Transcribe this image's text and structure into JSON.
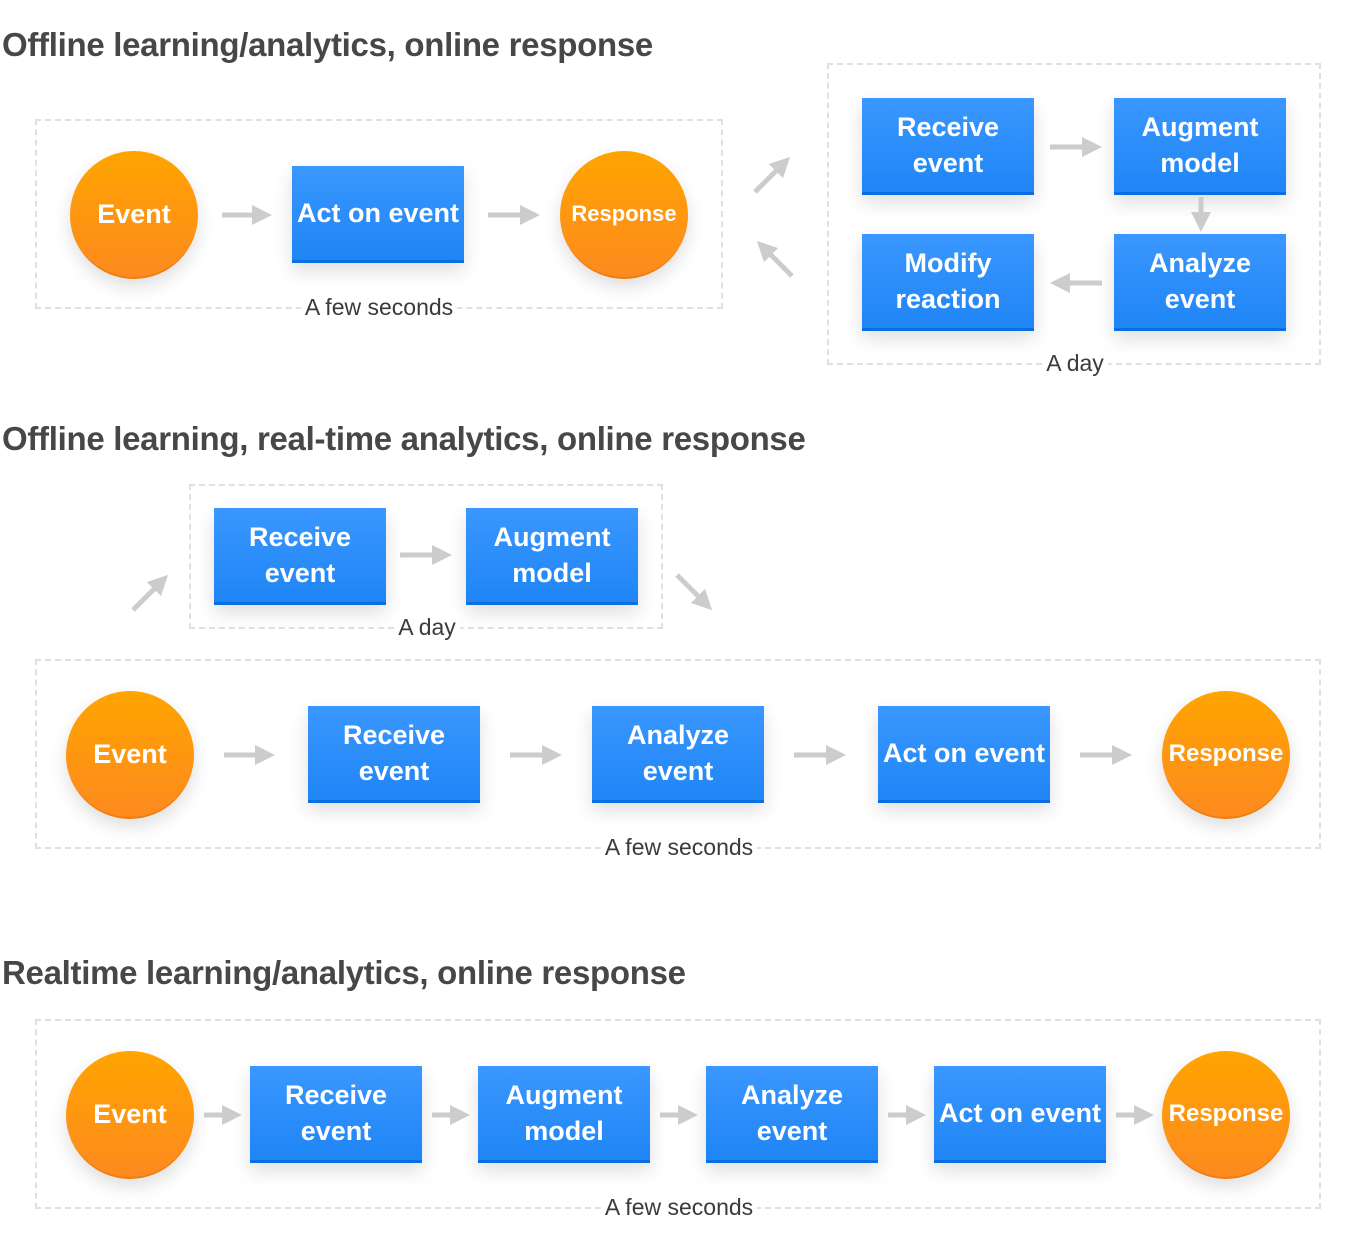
{
  "colors": {
    "box": "#2b8cfb",
    "circle": "#fd9a10",
    "arrow": "#cccccc",
    "title": "#474747",
    "frame": "#e0e0e0"
  },
  "sections": [
    {
      "title": "Offline learning/analytics, online response",
      "online": {
        "nodes": [
          "Event",
          "Act on event",
          "Response"
        ],
        "duration": "A few seconds"
      },
      "offline": {
        "nodes": [
          "Receive event",
          "Augment model",
          "Analyze event",
          "Modify reaction"
        ],
        "duration": "A day"
      }
    },
    {
      "title": "Offline learning, real-time analytics, online response",
      "offline": {
        "nodes": [
          "Receive event",
          "Augment model"
        ],
        "duration": "A day"
      },
      "online": {
        "nodes": [
          "Event",
          "Receive event",
          "Analyze event",
          "Act on event",
          "Response"
        ],
        "duration": "A few seconds"
      }
    },
    {
      "title": "Realtime learning/analytics, online response",
      "online": {
        "nodes": [
          "Event",
          "Receive event",
          "Augment model",
          "Analyze event",
          "Act on event",
          "Response"
        ],
        "duration": "A few seconds"
      }
    }
  ]
}
